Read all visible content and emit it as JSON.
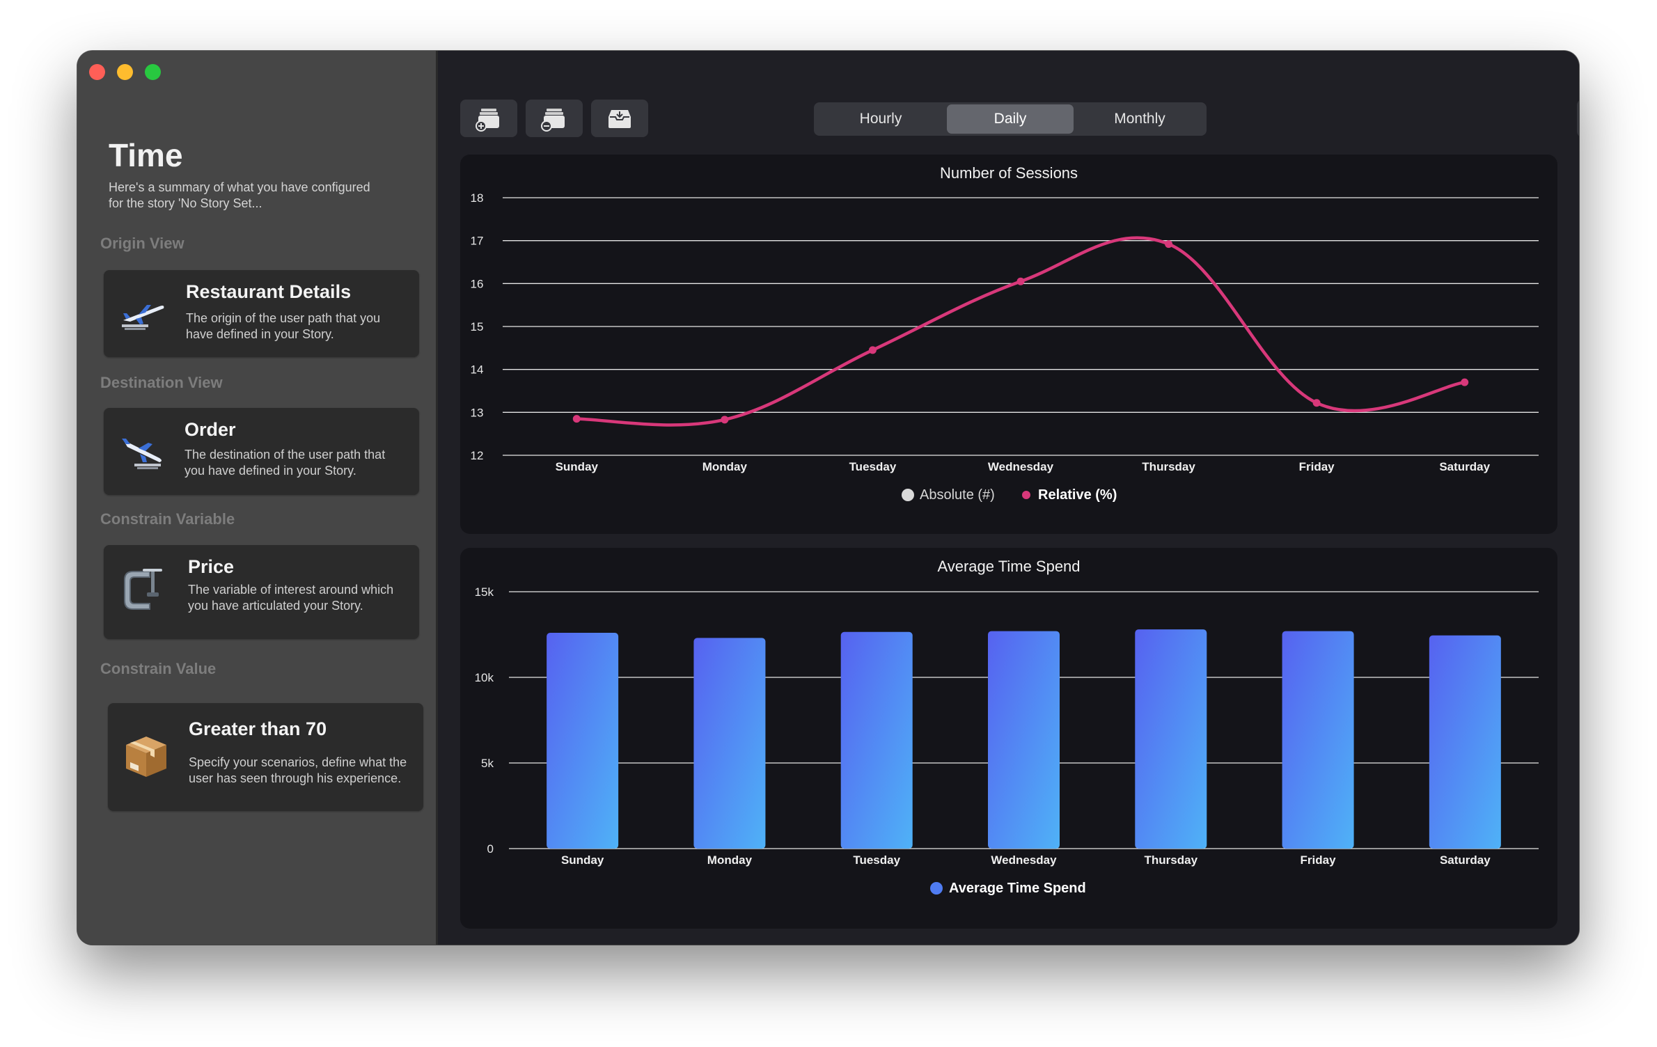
{
  "sidebar": {
    "title": "Time",
    "subtitle": "Here's a summary of what you have configured for the story 'No Story Set...",
    "sections": {
      "origin": {
        "label": "Origin View",
        "card_title": "Restaurant Details",
        "card_desc": "The origin of the user path that you have defined in your Story.",
        "icon": "airplane-takeoff-icon"
      },
      "destination": {
        "label": "Destination View",
        "card_title": "Order",
        "card_desc": "The destination of the user path that you have defined in your Story.",
        "icon": "airplane-landing-icon"
      },
      "variable": {
        "label": "Constrain Variable",
        "card_title": "Price",
        "card_desc": "The variable of interest around which you have articulated your Story.",
        "icon": "clamp-icon"
      },
      "value": {
        "label": "Constrain Value",
        "card_title": "Greater than 70",
        "card_desc": "Specify your scenarios, define what the user has seen through his experience.",
        "icon": "package-box-icon"
      }
    }
  },
  "toolbar": {
    "buttons": [
      "add-tray-icon",
      "remove-tray-icon",
      "archive-box-icon"
    ],
    "segments": [
      "Hourly",
      "Daily",
      "Monthly"
    ],
    "selected_segment": "Daily",
    "settings_icon": "wrench-icon"
  },
  "colors": {
    "line": "#d8387a",
    "bar_top": "#5662f0",
    "bar_bottom": "#4fb2f7",
    "legend_absolute": "#d9d9d9"
  },
  "chart_data": [
    {
      "type": "line",
      "title": "Number of Sessions",
      "categories": [
        "Sunday",
        "Monday",
        "Tuesday",
        "Wednesday",
        "Thursday",
        "Friday",
        "Saturday"
      ],
      "series": [
        {
          "name": "Relative (%)",
          "values": [
            12.85,
            12.83,
            14.45,
            16.05,
            16.92,
            13.22,
            13.7
          ]
        }
      ],
      "legend": [
        {
          "name": "Absolute (#)",
          "active": false
        },
        {
          "name": "Relative (%)",
          "active": true
        }
      ],
      "ylim": [
        12,
        18
      ],
      "yticks": [
        "12",
        "13",
        "14",
        "15",
        "16",
        "17",
        "18"
      ],
      "legend_position": "bottom",
      "grid": true
    },
    {
      "type": "bar",
      "title": "Average Time Spend",
      "categories": [
        "Sunday",
        "Monday",
        "Tuesday",
        "Wednesday",
        "Thursday",
        "Friday",
        "Saturday"
      ],
      "series": [
        {
          "name": "Average Time Spend",
          "values": [
            12600,
            12300,
            12650,
            12700,
            12800,
            12700,
            12450
          ]
        }
      ],
      "ylim": [
        0,
        15000
      ],
      "yticks": [
        {
          "v": 0,
          "label": "0"
        },
        {
          "v": 5000,
          "label": "5k"
        },
        {
          "v": 10000,
          "label": "10k"
        },
        {
          "v": 15000,
          "label": "15k"
        }
      ],
      "legend_position": "bottom",
      "grid": true
    }
  ]
}
